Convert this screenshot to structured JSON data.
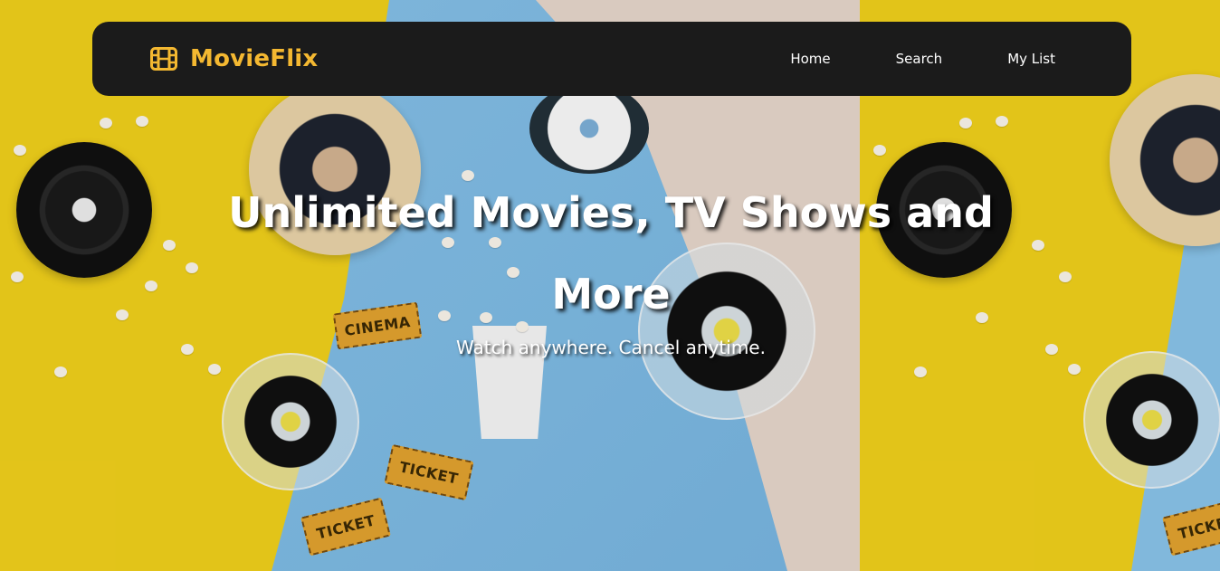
{
  "navbar": {
    "brand_name": "MovieFlix",
    "brand_icon": "film-icon",
    "links": [
      {
        "label": "Home"
      },
      {
        "label": "Search"
      },
      {
        "label": "My List"
      }
    ]
  },
  "hero": {
    "title": "Unlimited Movies, TV Shows and More",
    "subtitle": "Watch anywhere. Cancel anytime.",
    "background_image_tickets": [
      "CINEMA",
      "TICKET",
      "TICKET",
      "TICKET"
    ]
  },
  "colors": {
    "accent": "#f4b831",
    "navbar_bg": "#1b1b1b",
    "text": "#ffffff"
  }
}
